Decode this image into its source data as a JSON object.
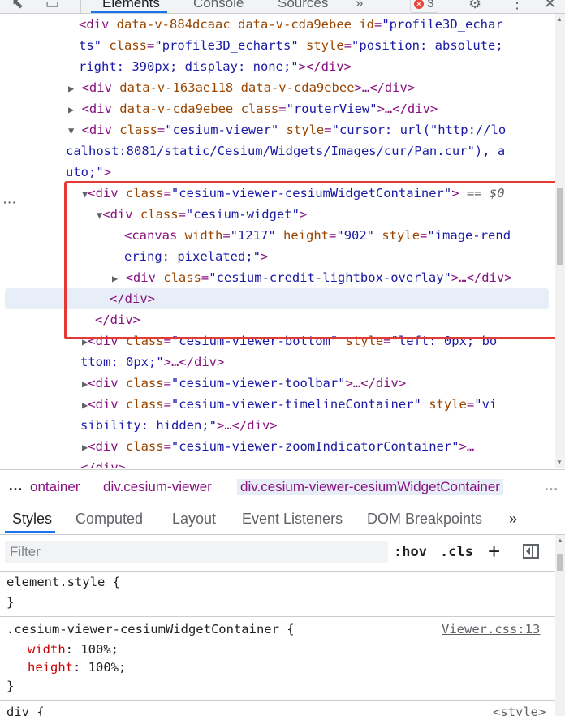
{
  "toolbar": {
    "tabs": [
      "Elements",
      "Console",
      "Sources"
    ],
    "active_tab": "Elements",
    "more": "»",
    "error_count": "3",
    "icons": [
      "inspect-icon",
      "device-toggle-icon",
      "gear-icon",
      "kebab-menu-icon"
    ]
  },
  "dom": {
    "l1": {
      "open": "<div ",
      "a1": "data-v-884dcaac",
      "a2": "data-v-cda9ebee",
      "a3": "id",
      "v3": "\"profile3D_echar"
    },
    "l2": {
      "t1": "ts\"",
      "a": "class",
      "v": "\"profile3D_echarts\"",
      "a2": "style",
      "v2": "\"position: absolute;"
    },
    "l3": {
      "v": "right: 390px; display: none;\"",
      "close": "></div>"
    },
    "l4": {
      "open": "<div ",
      "a1": "data-v-163ae118",
      "a2": "data-v-cda9ebee",
      "close": ">…</div>"
    },
    "l5": {
      "open": "<div ",
      "a1": "data-v-cda9ebee",
      "a2": "class",
      "v2": "\"routerView\"",
      "close": ">…</div>"
    },
    "l6": {
      "open": "<div ",
      "a1": "class",
      "v1": "\"cesium-viewer\"",
      "a2": "style",
      "v2": "\"cursor: url(\"http://lo"
    },
    "l7": {
      "v": "calhost:8081/static/Cesium/Widgets/Images/cur/Pan.cur\"), a"
    },
    "l8": {
      "v": "uto;\"",
      "close": ">"
    },
    "l9": {
      "open": "<div ",
      "a": "class",
      "v": "\"cesium-viewer-cesiumWidgetContainer\"",
      "close": ">",
      "eq": " == $0"
    },
    "l10": {
      "open": "<div ",
      "a": "class",
      "v": "\"cesium-widget\"",
      "close": ">"
    },
    "l11": {
      "open": "<canvas ",
      "a1": "width",
      "v1": "\"1217\"",
      "a2": "height",
      "v2": "\"902\"",
      "a3": "style",
      "v3": "\"image-rend"
    },
    "l12": {
      "v": "ering: pixelated;\"",
      "close": ">"
    },
    "l13": {
      "open": "<div ",
      "a": "class",
      "v": "\"cesium-credit-lightbox-overlay\"",
      "close": ">…</div>"
    },
    "l14": "</div>",
    "l15": "</div>",
    "l16": {
      "open": "<div ",
      "a": "class",
      "v": "\"cesium-viewer-bottom\"",
      "a2": "style",
      "v2": "\"left: 0px; bo"
    },
    "l17": {
      "v": "ttom: 0px;\"",
      "close": ">…</div>"
    },
    "l18": {
      "open": "<div ",
      "a": "class",
      "v": "\"cesium-viewer-toolbar\"",
      "close": ">…</div>"
    },
    "l19": {
      "open": "<div ",
      "a": "class",
      "v": "\"cesium-viewer-timelineContainer\"",
      "a2": "style",
      "v2": "\"vi"
    },
    "l20": {
      "v": "sibility: hidden;\"",
      "close": ">…</div>"
    },
    "l21": {
      "open": "<div ",
      "a": "class",
      "v": "\"cesium-viewer-zoomIndicatorContainer\"",
      "close": ">…"
    },
    "l22": "</div>"
  },
  "breadcrumb": {
    "lead": "…",
    "items": [
      "ontainer",
      "div.cesium-viewer",
      "div.cesium-viewer-cesiumWidgetContainer"
    ],
    "more": "…"
  },
  "styles_tabs": {
    "tabs": [
      "Styles",
      "Computed",
      "Layout",
      "Event Listeners",
      "DOM Breakpoints"
    ],
    "more": "»"
  },
  "filter": {
    "placeholder": "Filter",
    "value": "",
    "hov": ":hov",
    "cls": ".cls",
    "plus": "+"
  },
  "styles": {
    "element_style": "element.style {",
    "close1": "}",
    "rule_selector": ".cesium-viewer-cesiumWidgetContainer {",
    "rule_source": "Viewer.css:13",
    "props": [
      {
        "name": "width",
        "value": "100%;"
      },
      {
        "name": "height",
        "value": "100%;"
      }
    ],
    "close2": "}",
    "div_selector": "div {",
    "div_source": "<style>"
  }
}
